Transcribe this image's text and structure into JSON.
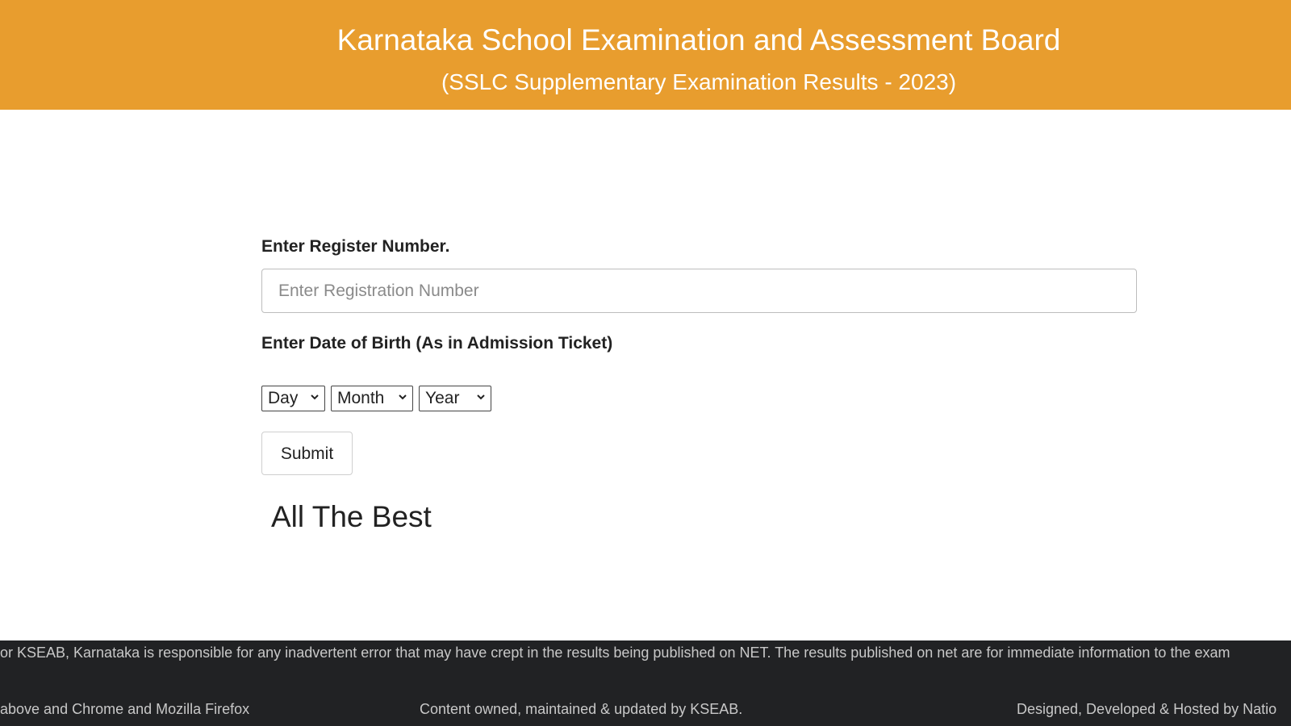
{
  "header": {
    "title": "Karnataka School Examination and Assessment Board",
    "subtitle": "(SSLC Supplementary Examination Results - 2023)"
  },
  "form": {
    "register_label": "Enter Register Number.",
    "register_placeholder": "Enter Registration Number",
    "register_value": "",
    "dob_label": "Enter Date of Birth (As in Admission Ticket)",
    "day_select": "Day",
    "month_select": "Month",
    "year_select": "Year",
    "submit_label": "Submit"
  },
  "message": "All The Best",
  "footer": {
    "marquee": "or KSEAB, Karnataka is responsible for any inadvertent error that may have crept in the results being published on NET. The results published on net are for immediate information to the exam",
    "browser_note": "above and Chrome and Mozilla Firefox",
    "ownership": "Content owned, maintained & updated by KSEAB.",
    "credits": "Designed, Developed & Hosted by Natio"
  },
  "colors": {
    "header_bg": "#e89d2e",
    "footer_bg": "#212224"
  },
  "icons": {
    "select_arrow": "chevron-down-icon"
  }
}
